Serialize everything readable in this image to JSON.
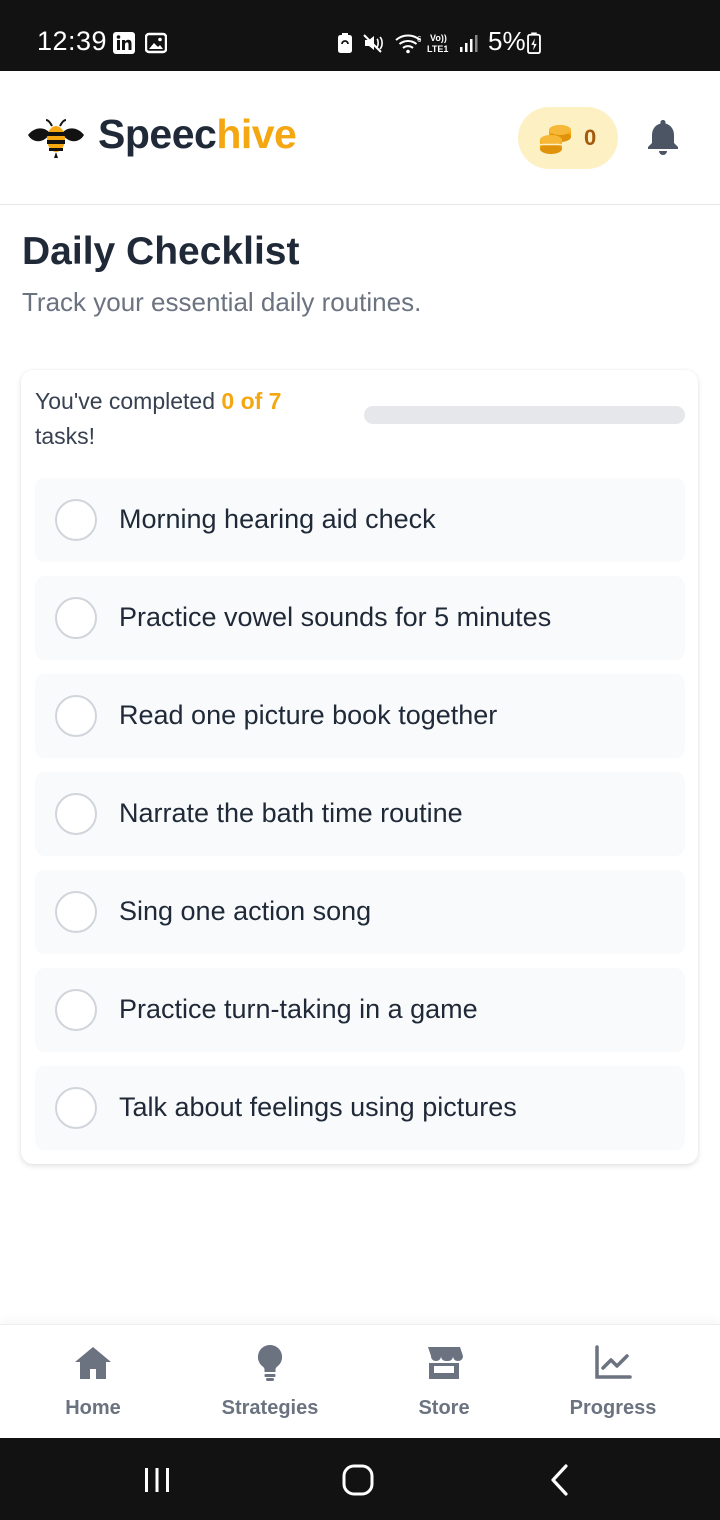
{
  "status_bar": {
    "time": "12:39",
    "battery_percent": "5%",
    "icons": [
      "linkedin-icon",
      "gallery-icon",
      "battery-saver-icon",
      "mute-icon",
      "wifi-icon",
      "volte-icon",
      "signal-icon",
      "battery-charging-icon"
    ]
  },
  "header": {
    "brand_part1": "Speec",
    "brand_part2": "hive",
    "coin_count": "0",
    "brand_color": "#f5a711"
  },
  "page": {
    "title": "Daily Checklist",
    "subtitle": "Track your essential daily routines."
  },
  "progress": {
    "text_prefix": "You've completed ",
    "text_highlight": "0 of 7",
    "text_suffix": "tasks!",
    "completed": 0,
    "total": 7,
    "fraction": 0
  },
  "tasks": [
    {
      "label": "Morning hearing aid check",
      "done": false
    },
    {
      "label": "Practice vowel sounds for 5 minutes",
      "done": false
    },
    {
      "label": "Read one picture book together",
      "done": false
    },
    {
      "label": "Narrate the bath time routine",
      "done": false
    },
    {
      "label": "Sing one action song",
      "done": false
    },
    {
      "label": "Practice turn-taking in a game",
      "done": false
    },
    {
      "label": "Talk about feelings using pictures",
      "done": false
    }
  ],
  "bottom_nav": [
    {
      "label": "Home",
      "icon": "home-icon"
    },
    {
      "label": "Strategies",
      "icon": "lightbulb-icon"
    },
    {
      "label": "Store",
      "icon": "store-icon"
    },
    {
      "label": "Progress",
      "icon": "chart-line-icon"
    }
  ],
  "system_nav": [
    "recents-button",
    "home-button",
    "back-button"
  ]
}
